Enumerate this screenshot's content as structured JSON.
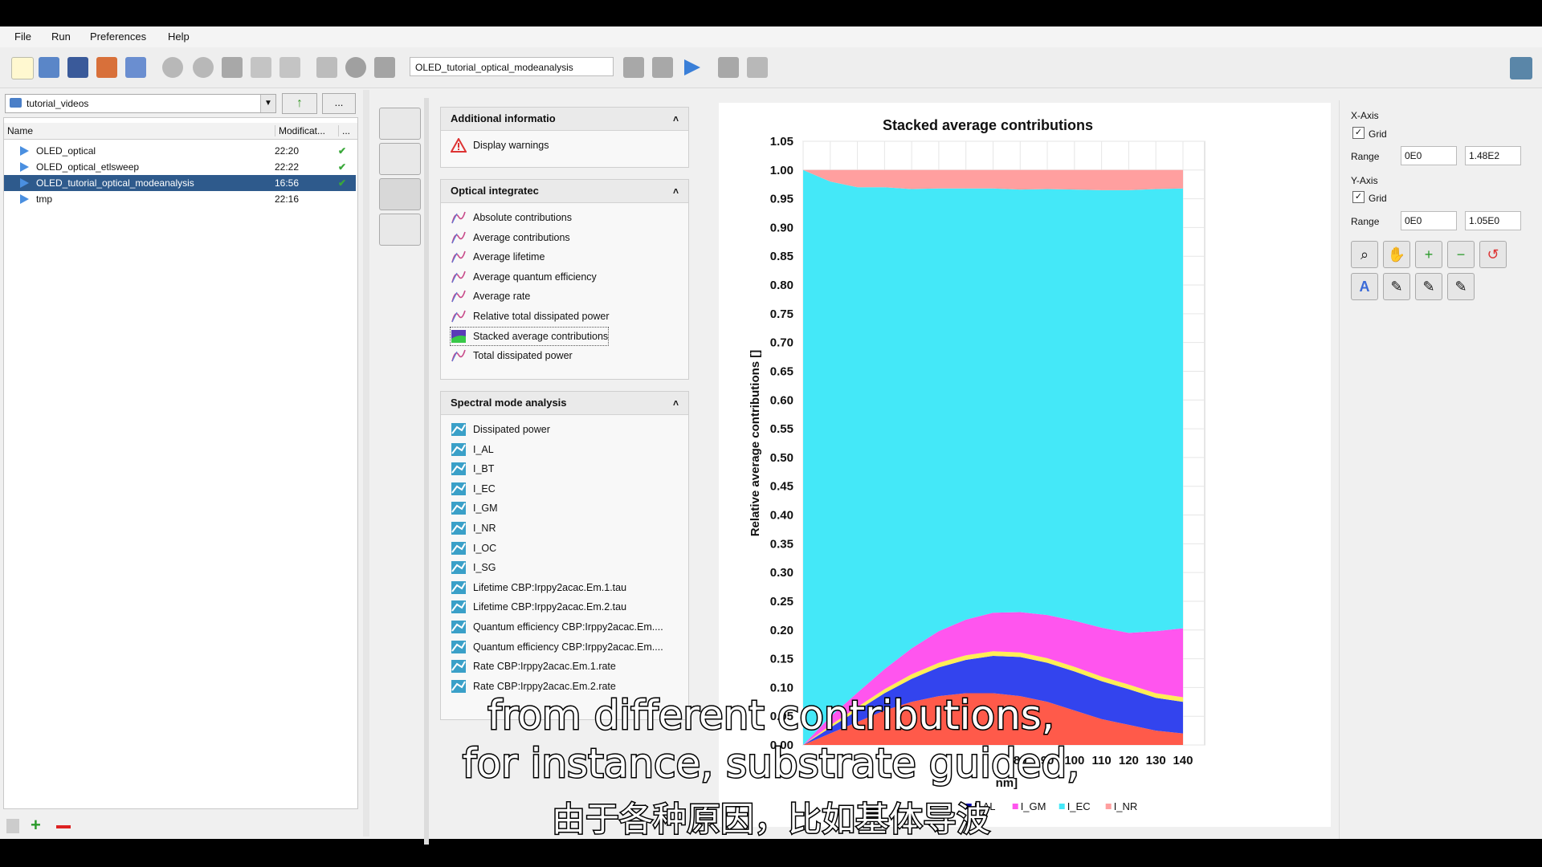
{
  "menu": [
    "File",
    "Run",
    "Preferences",
    "Help"
  ],
  "toolbar": {
    "simulation_combo": "OLED_tutorial_optical_modeanalysis"
  },
  "file_browser": {
    "folder": "tutorial_videos",
    "up_button": "↑",
    "more_button": "...",
    "columns": [
      "Name",
      "Modificat...",
      "..."
    ],
    "files": [
      {
        "name": "OLED_optical",
        "time": "22:20",
        "check": "✔"
      },
      {
        "name": "OLED_optical_etlsweep",
        "time": "22:22",
        "check": "✔"
      },
      {
        "name": "OLED_tutorial_optical_modeanalysis",
        "time": "16:56",
        "check": "✔"
      },
      {
        "name": "tmp",
        "time": "22:16",
        "check": ""
      }
    ]
  },
  "panels": {
    "additional": {
      "title": "Additional informatio",
      "items": [
        "Display warnings"
      ]
    },
    "optical": {
      "title": "Optical integratec",
      "items": [
        "Absolute contributions",
        "Average contributions",
        "Average lifetime",
        "Average quantum efficiency",
        "Average rate",
        "Relative total dissipated power",
        "Stacked average contributions",
        "Total dissipated power"
      ]
    },
    "spectral": {
      "title": "Spectral mode analysis",
      "items": [
        "Dissipated power",
        "I_AL",
        "I_BT",
        "I_EC",
        "I_GM",
        "I_NR",
        "I_OC",
        "I_SG",
        "Lifetime CBP:Irppy2acac.Em.1.tau",
        "Lifetime CBP:Irppy2acac.Em.2.tau",
        "Quantum efficiency CBP:Irppy2acac.Em....",
        "Quantum efficiency CBP:Irppy2acac.Em....",
        "Rate CBP:Irppy2acac.Em.1.rate",
        "Rate CBP:Irppy2acac.Em.2.rate"
      ]
    },
    "collapse_icon": "˄"
  },
  "chart_data": {
    "type": "area",
    "title": "Stacked average contributions",
    "ylabel": "Relative average contributions []",
    "xlabel_partial": "nm]",
    "xlim": [
      0,
      140
    ],
    "ylim": [
      0,
      1.05
    ],
    "yticks": [
      "1.05",
      "1.00",
      "0.95",
      "0.90",
      "0.85",
      "0.80",
      "0.75",
      "0.70",
      "0.65",
      "0.60",
      "0.55",
      "0.50",
      "0.45",
      "0.40",
      "0.35",
      "0.30",
      "0.25",
      "0.20",
      "0.15",
      "0.10",
      "0.05",
      "0.00"
    ],
    "xticks_visible": [
      "80",
      "90",
      "100",
      "110",
      "120",
      "130",
      "140"
    ],
    "x": [
      0,
      10,
      20,
      30,
      40,
      50,
      60,
      70,
      80,
      90,
      100,
      110,
      120,
      130,
      140
    ],
    "series": [
      {
        "name": "",
        "color": "#ff5a4a",
        "values": [
          0.0,
          0.02,
          0.04,
          0.06,
          0.075,
          0.085,
          0.09,
          0.09,
          0.085,
          0.075,
          0.06,
          0.045,
          0.035,
          0.025,
          0.02
        ]
      },
      {
        "name": "",
        "color": "#3344ee",
        "values": [
          0.0,
          0.01,
          0.02,
          0.03,
          0.04,
          0.05,
          0.058,
          0.065,
          0.068,
          0.068,
          0.068,
          0.066,
          0.062,
          0.057,
          0.055
        ]
      },
      {
        "name": "",
        "color": "#ffee55",
        "values": [
          0.0,
          0.004,
          0.006,
          0.007,
          0.008,
          0.008,
          0.008,
          0.008,
          0.008,
          0.008,
          0.008,
          0.008,
          0.008,
          0.008,
          0.008
        ]
      },
      {
        "name": "I_AL",
        "color": "#0000aa",
        "values": [
          0.0,
          0.0,
          0.0,
          0.0,
          0.0,
          0.0,
          0.0,
          0.0,
          0.0,
          0.0,
          0.0,
          0.0,
          0.0,
          0.0,
          0.0
        ]
      },
      {
        "name": "I_GM",
        "color": "#ff55ee",
        "values": [
          0.0,
          0.015,
          0.025,
          0.035,
          0.045,
          0.055,
          0.062,
          0.067,
          0.07,
          0.075,
          0.08,
          0.085,
          0.09,
          0.108,
          0.12
        ]
      },
      {
        "name": "I_EC",
        "color": "#44e8f8",
        "values": [
          1.0,
          0.931,
          0.879,
          0.838,
          0.799,
          0.77,
          0.75,
          0.738,
          0.735,
          0.741,
          0.75,
          0.761,
          0.77,
          0.769,
          0.765
        ]
      },
      {
        "name": "I_NR",
        "color": "#ff9f9f",
        "values": [
          0.0,
          0.02,
          0.03,
          0.03,
          0.033,
          0.032,
          0.032,
          0.032,
          0.034,
          0.033,
          0.034,
          0.035,
          0.035,
          0.033,
          0.032
        ]
      }
    ],
    "grid": true
  },
  "axes_panel": {
    "x_axis_label": "X-Axis",
    "y_axis_label": "Y-Axis",
    "grid_label": "Grid",
    "range_label": "Range",
    "x_min": "0E0",
    "x_max": "1.48E2",
    "y_min": "0E0",
    "y_max": "1.05E0",
    "check": "✓"
  },
  "subtitles": {
    "line1": "from different contributions,",
    "line2": "for instance, substrate guided,",
    "line3": "由于各种原因，比如基体导波"
  }
}
